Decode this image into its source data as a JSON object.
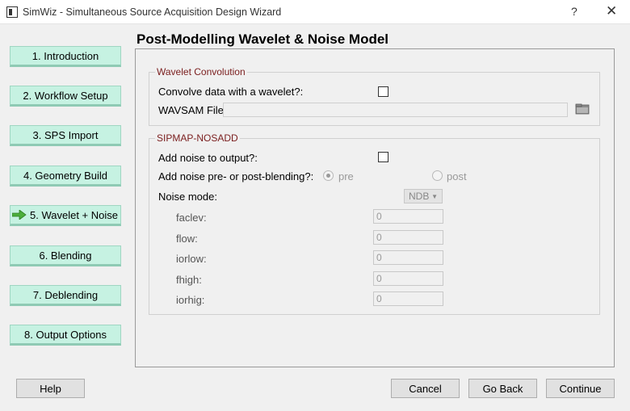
{
  "window": {
    "title": "SimWiz - Simultaneous Source Acquisition Design Wizard",
    "help_glyph": "?",
    "close_glyph": "✕"
  },
  "page": {
    "heading": "Post-Modelling Wavelet & Noise Model"
  },
  "nav": {
    "items": [
      {
        "label": "1. Introduction"
      },
      {
        "label": "2. Workflow Setup"
      },
      {
        "label": "3. SPS Import"
      },
      {
        "label": "4. Geometry Build"
      },
      {
        "label": "5. Wavelet + Noise",
        "active": true
      },
      {
        "label": "6. Blending"
      },
      {
        "label": "7. Deblending"
      },
      {
        "label": "8. Output Options"
      }
    ],
    "button_color": "#c6f2e2",
    "arrow_color": "#4caf3c"
  },
  "wavelet_group": {
    "title": "Wavelet Convolution",
    "convolve_label": "Convolve data with a wavelet?:",
    "convolve_checked": false,
    "wavsam_label": "WAVSAM File:",
    "wavsam_value": ""
  },
  "noise_group": {
    "title": "SIPMAP-NOSADD",
    "add_noise_label": "Add noise to output?:",
    "add_noise_checked": false,
    "pre_post_label": "Add noise pre- or post-blending?:",
    "pre_label": "pre",
    "post_label": "post",
    "selected_option": "pre",
    "noise_mode_label": "Noise mode:",
    "noise_mode_value": "NDB",
    "params": [
      {
        "label": "faclev:",
        "value": "0"
      },
      {
        "label": "flow:",
        "value": "0"
      },
      {
        "label": "iorlow:",
        "value": "0"
      },
      {
        "label": "fhigh:",
        "value": "0"
      },
      {
        "label": "iorhig:",
        "value": "0"
      }
    ]
  },
  "footer": {
    "help_label": "Help",
    "cancel_label": "Cancel",
    "back_label": "Go Back",
    "continue_label": "Continue"
  }
}
